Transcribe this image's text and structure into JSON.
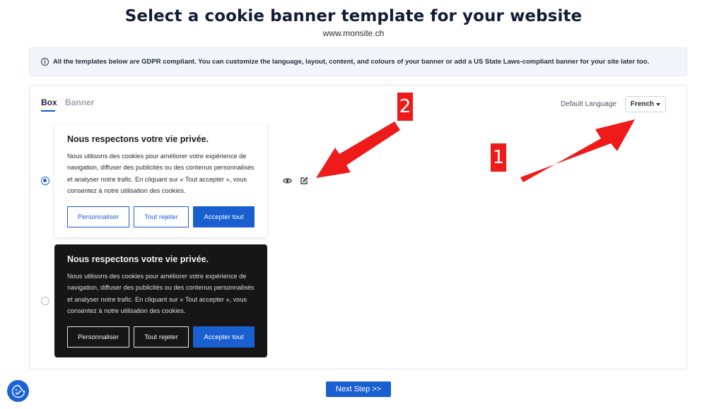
{
  "header": {
    "title": "Select a cookie banner template for your website",
    "site_url": "www.monsite.ch"
  },
  "info": {
    "icon": "info-icon",
    "icon_glyph": "i",
    "text": "All the templates below are GDPR compliant. You can customize the language, layout, content, and colours of your banner or add a US State Laws-compliant banner for your site later too."
  },
  "tabs": [
    {
      "label": "Box",
      "active": true
    },
    {
      "label": "Banner",
      "active": false
    }
  ],
  "language": {
    "label": "Default Language",
    "selected": "French"
  },
  "templates": [
    {
      "theme": "light",
      "selected": true,
      "title": "Nous respectons votre vie privée.",
      "body": "Nous utilisons des cookies pour améliorer votre expérience de navigation, diffuser des publicités ou des contenus personnalisés et analyser notre trafic. En cliquant sur « Tout accepter », vous consentez à notre utilisation des cookies.",
      "buttons": {
        "customize": "Personnaliser",
        "reject": "Tout rejeter",
        "accept": "Accepter tout"
      }
    },
    {
      "theme": "dark",
      "selected": false,
      "title": "Nous respectons votre vie privée.",
      "body": "Nous utilisons des cookies pour améliorer votre expérience de navigation, diffuser des publicités ou des contenus personnalisés et analyser notre trafic. En cliquant sur « Tout accepter », vous consentez à notre utilisation des cookies.",
      "buttons": {
        "customize": "Personnaliser",
        "reject": "Tout rejeter",
        "accept": "Accepter tout"
      }
    }
  ],
  "actions": {
    "preview_icon": "eye-icon",
    "edit_icon": "edit-icon"
  },
  "annotations": [
    {
      "label": "1",
      "color": "#ef1a1a"
    },
    {
      "label": "2",
      "color": "#ef1a1a"
    }
  ],
  "footer": {
    "next_label": "Next Step >>"
  },
  "colors": {
    "accent": "#1a5fd0",
    "title": "#141c35",
    "annotation": "#ef1a1a",
    "dark_card": "#161616"
  }
}
